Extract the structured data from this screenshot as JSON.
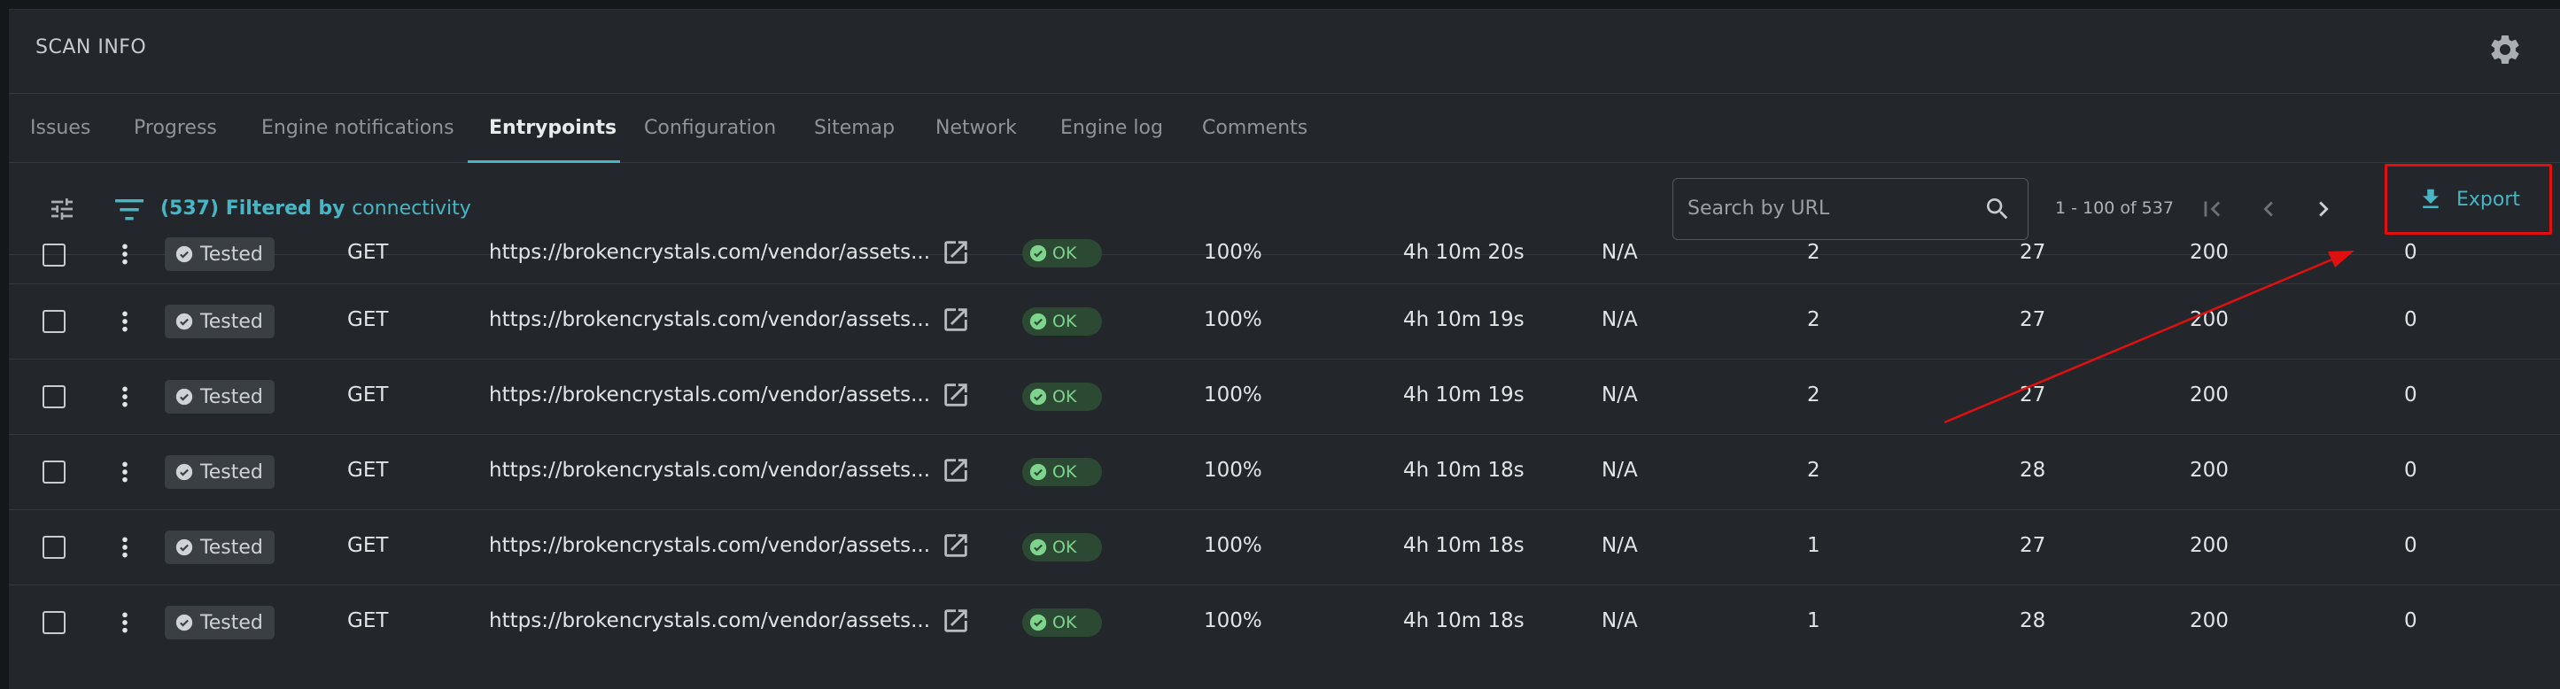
{
  "header": {
    "title": "SCAN INFO",
    "settings_icon": "gear-icon"
  },
  "tabs": [
    {
      "label": "Issues",
      "active": false
    },
    {
      "label": "Progress",
      "active": false
    },
    {
      "label": "Engine notifications",
      "active": false
    },
    {
      "label": "Entrypoints",
      "active": true
    },
    {
      "label": "Configuration",
      "active": false
    },
    {
      "label": "Sitemap",
      "active": false
    },
    {
      "label": "Network",
      "active": false
    },
    {
      "label": "Engine log",
      "active": false
    },
    {
      "label": "Comments",
      "active": false
    }
  ],
  "toolbar": {
    "filter_count": "(537) Filtered by",
    "filter_link": "connectivity",
    "search_placeholder": "Search by URL",
    "page_range": "1 - 100 of 537",
    "export_label": "Export"
  },
  "rows": [
    {
      "status": "Tested",
      "method": "GET",
      "url": "https://brokencrystals.com/vendor/assets...",
      "connectivity": "OK",
      "progress": "100%",
      "time": "4h 10m 20s",
      "na": "N/A",
      "c1": "2",
      "c2": "27",
      "code": "200",
      "c3": "0"
    },
    {
      "status": "Tested",
      "method": "GET",
      "url": "https://brokencrystals.com/vendor/assets...",
      "connectivity": "OK",
      "progress": "100%",
      "time": "4h 10m 19s",
      "na": "N/A",
      "c1": "2",
      "c2": "27",
      "code": "200",
      "c3": "0"
    },
    {
      "status": "Tested",
      "method": "GET",
      "url": "https://brokencrystals.com/vendor/assets...",
      "connectivity": "OK",
      "progress": "100%",
      "time": "4h 10m 19s",
      "na": "N/A",
      "c1": "2",
      "c2": "27",
      "code": "200",
      "c3": "0"
    },
    {
      "status": "Tested",
      "method": "GET",
      "url": "https://brokencrystals.com/vendor/assets...",
      "connectivity": "OK",
      "progress": "100%",
      "time": "4h 10m 18s",
      "na": "N/A",
      "c1": "2",
      "c2": "28",
      "code": "200",
      "c3": "0"
    },
    {
      "status": "Tested",
      "method": "GET",
      "url": "https://brokencrystals.com/vendor/assets...",
      "connectivity": "OK",
      "progress": "100%",
      "time": "4h 10m 18s",
      "na": "N/A",
      "c1": "1",
      "c2": "27",
      "code": "200",
      "c3": "0"
    },
    {
      "status": "Tested",
      "method": "GET",
      "url": "https://brokencrystals.com/vendor/assets...",
      "connectivity": "OK",
      "progress": "100%",
      "time": "4h 10m 18s",
      "na": "N/A",
      "c1": "1",
      "c2": "28",
      "code": "200",
      "c3": "0"
    }
  ],
  "colors": {
    "accent": "#48b5c4",
    "ok_badge": "#2c4a33",
    "ok_text": "#7ed48d",
    "annotation": "#e01010"
  }
}
